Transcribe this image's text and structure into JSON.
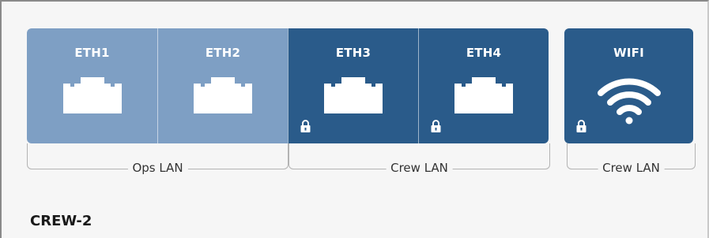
{
  "ports": [
    {
      "label": "ETH1",
      "locked": false,
      "style": "light"
    },
    {
      "label": "ETH2",
      "locked": false,
      "style": "light"
    },
    {
      "label": "ETH3",
      "locked": true,
      "style": "dark"
    },
    {
      "label": "ETH4",
      "locked": true,
      "style": "dark"
    }
  ],
  "wifi": {
    "label": "WIFI",
    "locked": true
  },
  "groups": [
    {
      "label": "Ops LAN"
    },
    {
      "label": "Crew LAN"
    },
    {
      "label": "Crew LAN"
    }
  ],
  "device_name": "CREW-2",
  "colors": {
    "light_port": "#7e9fc4",
    "dark_port": "#2a5b8a",
    "icon": "#ffffff"
  },
  "icons": {
    "ethernet": "ethernet-port-icon",
    "wifi": "wifi-icon",
    "lock": "lock-icon"
  }
}
